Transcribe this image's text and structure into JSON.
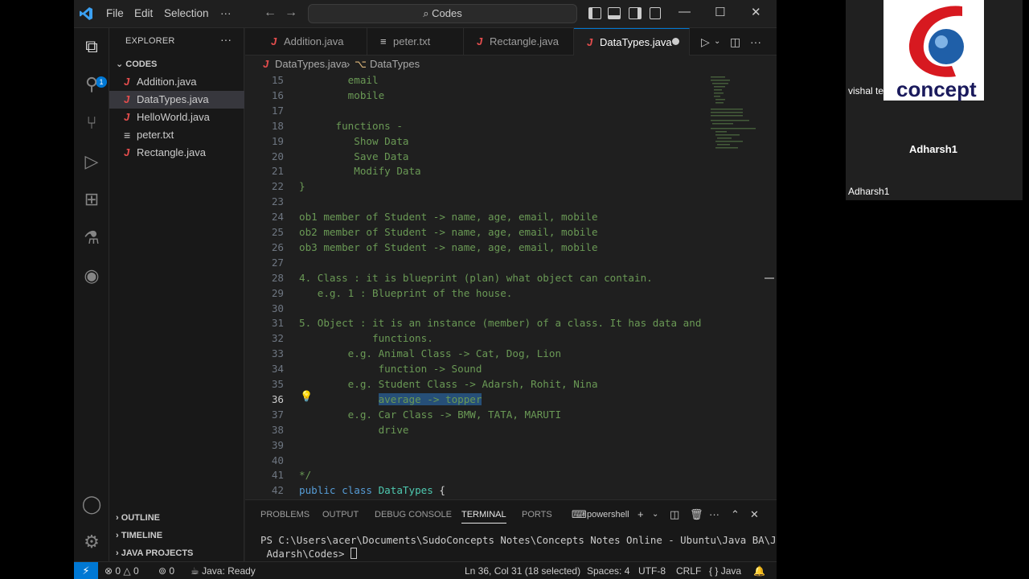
{
  "titlebar": {
    "menus": [
      "File",
      "Edit",
      "Selection",
      "···"
    ],
    "command_center": "Codes",
    "icons": [
      "back-arrow-icon",
      "forward-arrow-icon",
      "toggle-sidebar-icon",
      "toggle-panel-icon",
      "toggle-secondary-sidebar-icon",
      "customize-layout-icon"
    ],
    "window_controls": [
      "—",
      "☐",
      "✕"
    ]
  },
  "activity_bar": {
    "items": [
      "explorer-icon",
      "search-icon",
      "source-control-icon",
      "run-debug-icon",
      "extensions-icon",
      "testing-icon",
      "remote-icon",
      "account-icon",
      "settings-icon"
    ],
    "badge": "1"
  },
  "sidebar": {
    "title": "EXPLORER",
    "dots": "···",
    "folder": "CODES",
    "files": [
      {
        "name": "Addition.java",
        "type": "java"
      },
      {
        "name": "DataTypes.java",
        "type": "java",
        "active": true
      },
      {
        "name": "HelloWorld.java",
        "type": "java"
      },
      {
        "name": "peter.txt",
        "type": "txt"
      },
      {
        "name": "Rectangle.java",
        "type": "java"
      }
    ],
    "lower_sections": [
      "OUTLINE",
      "TIMELINE",
      "JAVA PROJECTS"
    ]
  },
  "tabs": [
    {
      "name": "Addition.java",
      "type": "java"
    },
    {
      "name": "peter.txt",
      "type": "txt"
    },
    {
      "name": "Rectangle.java",
      "type": "java"
    },
    {
      "name": "DataTypes.java",
      "type": "java",
      "active": true,
      "modified": true
    }
  ],
  "breadcrumb": {
    "file": "DataTypes.java",
    "separator": "›",
    "symbol": "DataTypes"
  },
  "editor": {
    "lines": [
      {
        "n": "15",
        "text": "        email"
      },
      {
        "n": "16",
        "text": "        mobile"
      },
      {
        "n": "17",
        "text": ""
      },
      {
        "n": "18",
        "text": "      functions -"
      },
      {
        "n": "19",
        "text": "         Show Data"
      },
      {
        "n": "20",
        "text": "         Save Data"
      },
      {
        "n": "21",
        "text": "         Modify Data"
      },
      {
        "n": "22",
        "text": "}"
      },
      {
        "n": "23",
        "text": ""
      },
      {
        "n": "24",
        "text": "ob1 member of Student -> name, age, email, mobile"
      },
      {
        "n": "25",
        "text": "ob2 member of Student -> name, age, email, mobile"
      },
      {
        "n": "26",
        "text": "ob3 member of Student -> name, age, email, mobile"
      },
      {
        "n": "27",
        "text": ""
      },
      {
        "n": "28",
        "text": "4. Class : it is blueprint (plan) what object can contain."
      },
      {
        "n": "29",
        "text": "   e.g. 1 : Blueprint of the house."
      },
      {
        "n": "30",
        "text": ""
      },
      {
        "n": "31",
        "text": "5. Object : it is an instance (member) of a class. It has data and"
      },
      {
        "n": "32",
        "text": "            functions."
      },
      {
        "n": "33",
        "text": "        e.g. Animal Class -> Cat, Dog, Lion"
      },
      {
        "n": "34",
        "text": "             function -> Sound"
      },
      {
        "n": "35",
        "text": "        e.g. Student Class -> Adarsh, Rohit, Nina"
      },
      {
        "n": "36",
        "text": "             average -> topper",
        "selected": "average -> topper",
        "current": true
      },
      {
        "n": "37",
        "text": "        e.g. Car Class -> BMW, TATA, MARUTI"
      },
      {
        "n": "38",
        "text": "             drive"
      },
      {
        "n": "39",
        "text": ""
      },
      {
        "n": "40",
        "text": ""
      },
      {
        "n": "41",
        "text": "*/"
      },
      {
        "n": "42",
        "text": "public class DataTypes {",
        "code": true
      }
    ]
  },
  "panel": {
    "tabs": [
      "PROBLEMS",
      "OUTPUT",
      "DEBUG CONSOLE",
      "TERMINAL",
      "PORTS"
    ],
    "active_tab": "TERMINAL",
    "shell": "powershell",
    "terminal_lines": [
      "PS C:\\Users\\acer\\Documents\\SudoConcepts Notes\\Concepts Notes Online - Ubuntu\\Java BA\\Java",
      " Adarsh\\Codes> "
    ]
  },
  "statusbar": {
    "errors": "0",
    "warnings": "0",
    "ports": "0",
    "java": "Java: Ready",
    "position": "Ln 36, Col 31 (18 selected)",
    "spaces": "Spaces: 4",
    "encoding": "UTF-8",
    "eol": "CRLF",
    "language": "Java"
  },
  "video": {
    "presenter_name": "vishal teli",
    "logo_text": "concept",
    "participant_center": "Adharsh1",
    "participant_label": "Adharsh1"
  }
}
